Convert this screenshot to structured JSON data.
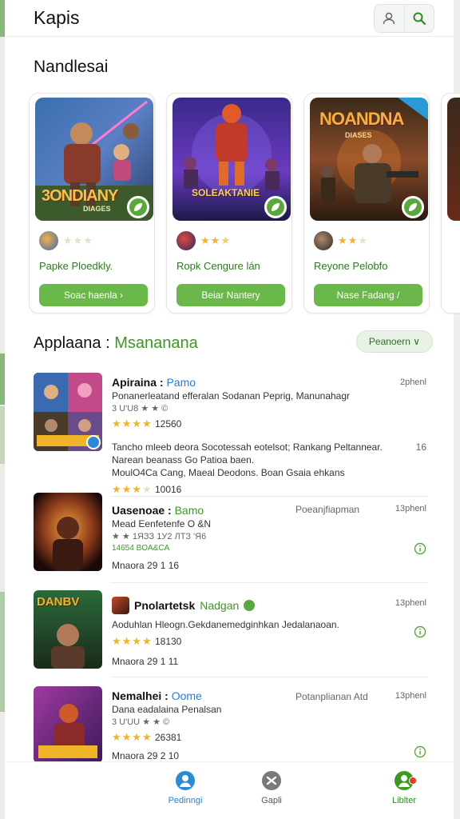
{
  "header": {
    "title": "Kapis",
    "profile_icon": "user-icon",
    "search_icon": "search-icon"
  },
  "featured": {
    "title": "Nandlesai",
    "cards": [
      {
        "art_title": "3ONDIANY",
        "art_subtitle": "DIAGES",
        "name": "Papke Ploedkly.",
        "button": "Soac haenla  ›",
        "rating": 0
      },
      {
        "art_title": "SOLEAKTANIE",
        "art_subtitle": "",
        "name": "Ropk Cengure lán",
        "button": "Beiar Nantery",
        "rating": 3
      },
      {
        "art_title": "NOANDNA",
        "art_subtitle": "DIASES",
        "name": "Reyone Pelobfo",
        "button": "Nase Fadang  /",
        "rating": 2
      }
    ]
  },
  "apps_section": {
    "title_prefix": "Applaana : ",
    "title_accent": "Msananana",
    "filter_label": "Peanoern ∨"
  },
  "list": [
    {
      "name": "Apiraina : ",
      "tag": "Pamo",
      "time": "2phenl",
      "line1": "Ponanerleatand efferalan Sodanan Peprig, Manunahagr",
      "line2": "3 U'U8 ★ ★ © ",
      "rating_text": "12560",
      "extra1": "Tancho mleeb deora Socotessah eotelsot; Rankang Peltannear.",
      "extra1_right": "16",
      "extra2": "Narean beanass Go Patioa baen.",
      "extra3": "MoulO4Ca Cang, Maeal Deodons. Boan Gsaia ehkans",
      "rating2_text": "10016"
    },
    {
      "name": "Uasenoae : ",
      "tag": "Bamo",
      "status": "Poeanjfiapman",
      "time": "13phenl",
      "line1": "Mead Eenfetenfe  O &N",
      "line2": "★ ★ 1ЯЗЗ  1У2 ЛТЗ 'Я6",
      "line3": "14654  BOA&CA",
      "date": "Mnaora 29 1 16"
    },
    {
      "name": "Pnolartetsk ",
      "tag": "Nadgan",
      "time": "13phenl",
      "line1": "Aoduhlan Hleogn.Gekdanemedginhkan Jedalanaoan.",
      "rating_text": "18130",
      "date": "Mnaora 29 1 11"
    },
    {
      "name": "Nemalhei : ",
      "tag": "Oome",
      "status": "Potanplianan Atd",
      "time": "13phenl",
      "line1": "Dana eadalaina Penalsan",
      "line2": "3 U'UU ★ ★ ©",
      "rating_text": "26381",
      "date": "Mnaora 29 2 10"
    }
  ],
  "nav": [
    {
      "label": "Pedinngi",
      "icon": "person-icon",
      "active": true
    },
    {
      "label": "Gapli",
      "icon": "controller-icon",
      "active": false
    },
    {
      "label": "Liblter",
      "icon": "library-icon",
      "active": false
    }
  ],
  "colors": {
    "accent": "#6ab84a",
    "accent_dark": "#2c7a1f",
    "star": "#f0b429",
    "link": "#2a7bd6"
  }
}
